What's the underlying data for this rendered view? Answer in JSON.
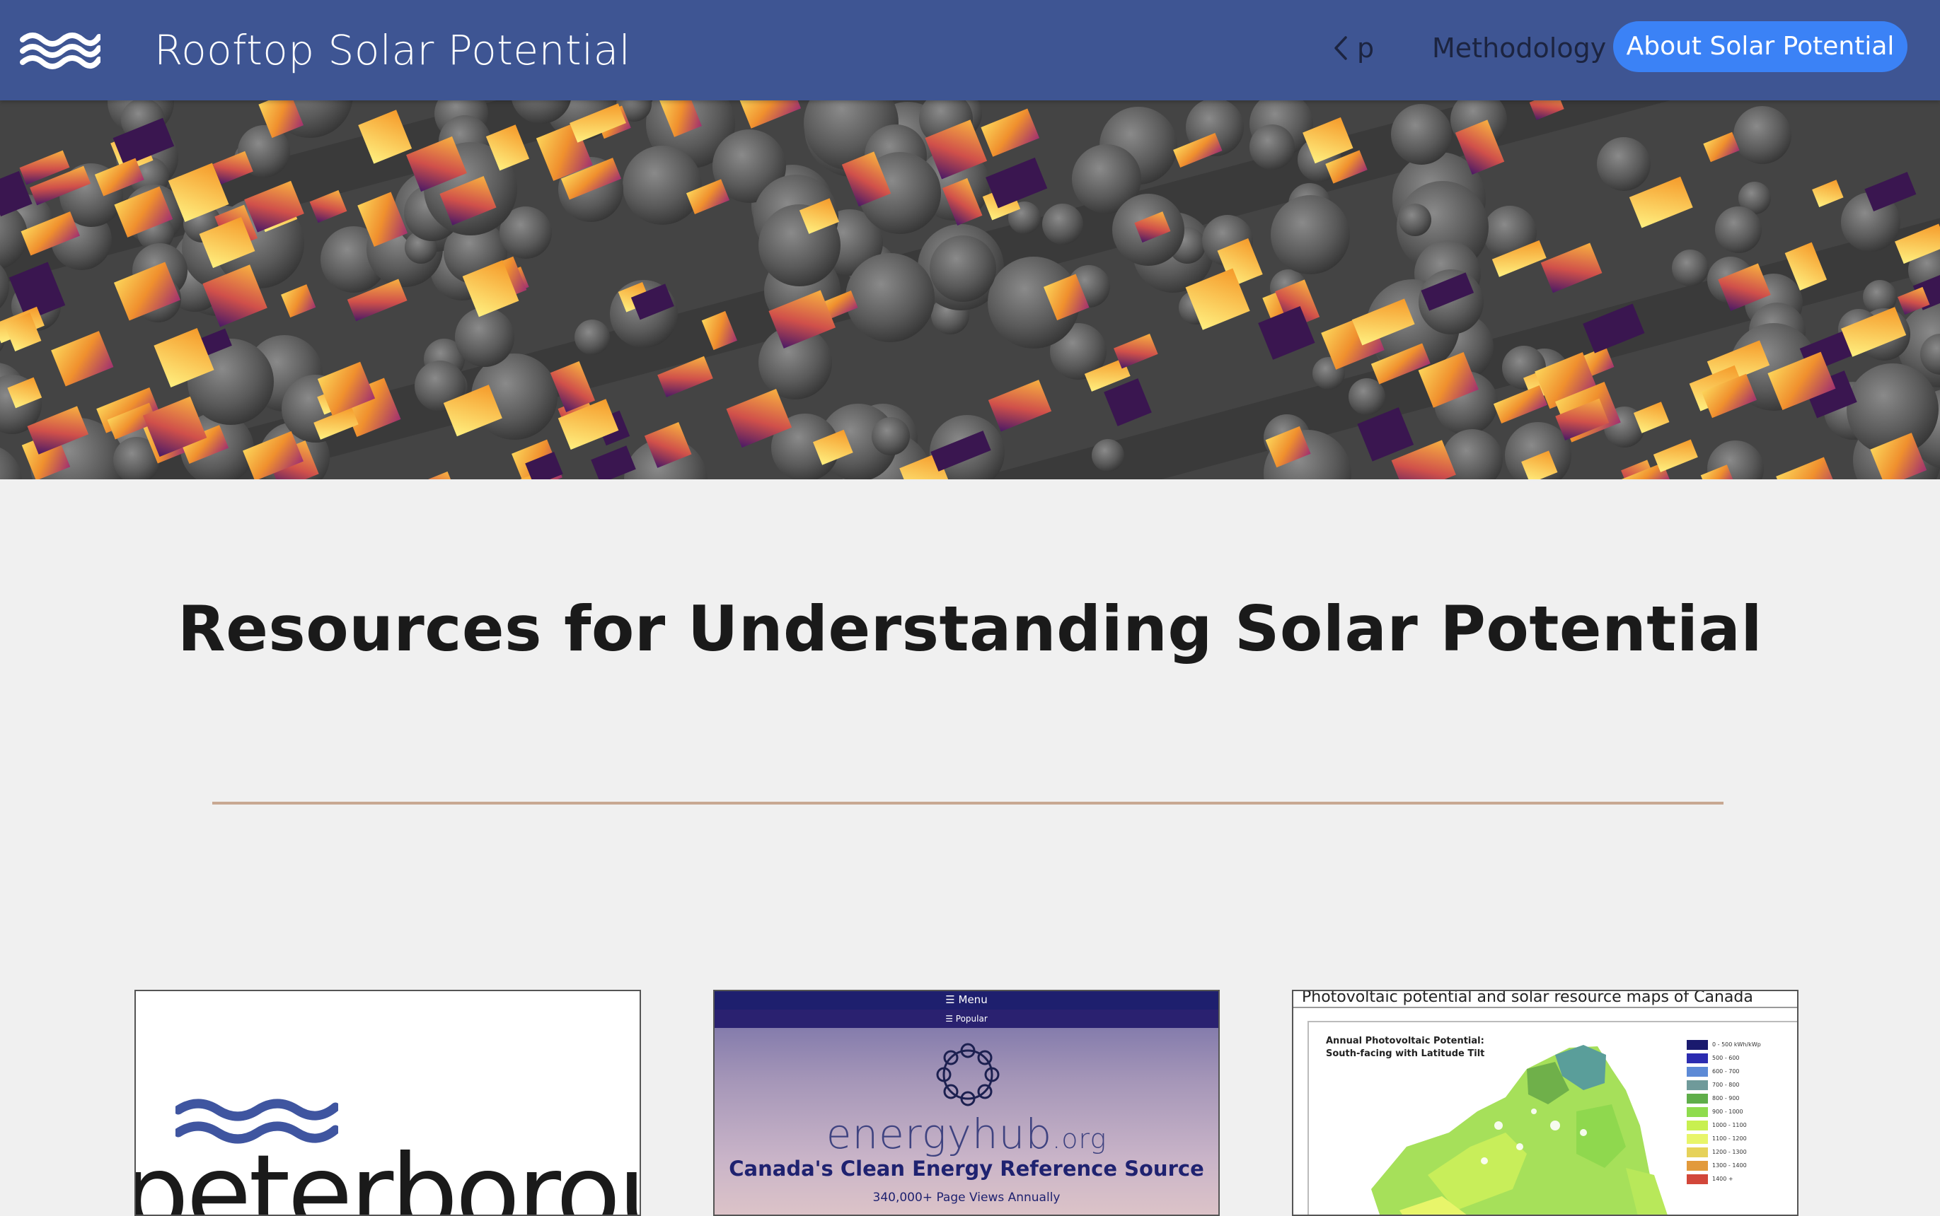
{
  "header": {
    "site_title": "Rooftop Solar Potential",
    "back_label": "p",
    "nav": [
      {
        "label": "Methodology"
      },
      {
        "label": "About Solar Potential"
      }
    ],
    "accent_color": "#3e5593",
    "button_color": "#3b82f6"
  },
  "main": {
    "heading": "Resources for Understanding Solar Potential",
    "divider_color": "#c8a892"
  },
  "cards": [
    {
      "name": "peterborough",
      "wordmark": "peterboroug"
    },
    {
      "name": "energyhub",
      "menu": "☰ Menu",
      "popular": "☰ Popular",
      "brand_main": "energyhub",
      "brand_suffix": ".org",
      "tagline": "Canada's Clean Energy Reference Source",
      "views": "340,000+ Page Views Annually"
    },
    {
      "name": "nrcan-pv-maps",
      "title": "Photovoltaic potential and solar resource maps of Canada",
      "map_title_1": "Annual Photovoltaic Potential:",
      "map_title_2": "South-facing with Latitude Tilt",
      "legend": [
        {
          "label": "0 - 500 kWh/kWp",
          "color": "#1a1a6e"
        },
        {
          "label": "500 - 600",
          "color": "#2c2cb0"
        },
        {
          "label": "600 - 700",
          "color": "#5d8ad6"
        },
        {
          "label": "700 - 800",
          "color": "#6f9a9a"
        },
        {
          "label": "800 - 900",
          "color": "#5fae4a"
        },
        {
          "label": "900 - 1000",
          "color": "#8fdc4e"
        },
        {
          "label": "1000 - 1100",
          "color": "#c8f050"
        },
        {
          "label": "1100 - 1200",
          "color": "#e8f56a"
        },
        {
          "label": "1200 - 1300",
          "color": "#e6d25a"
        },
        {
          "label": "1300 - 1400",
          "color": "#e29a3c"
        },
        {
          "label": "1400 +",
          "color": "#d2473a"
        }
      ]
    }
  ]
}
